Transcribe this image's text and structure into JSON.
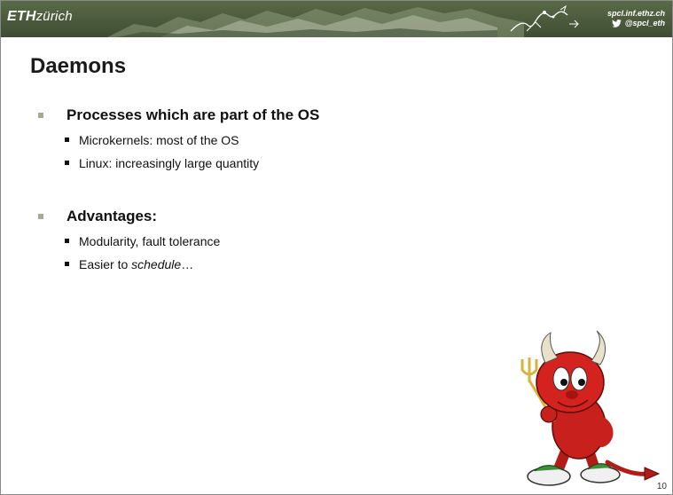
{
  "header": {
    "logo_bold": "ETH",
    "logo_text": "zürich",
    "website": "spcl.inf.ethz.ch",
    "twitter": "@spcl_eth",
    "icons": [
      "twitter-icon",
      "spcl-sketch-icon"
    ]
  },
  "slide": {
    "title": "Daemons",
    "bullets": [
      {
        "text": "Processes which are part of the OS",
        "children": [
          "Microkernels: most of the OS",
          "Linux: increasingly large quantity"
        ]
      },
      {
        "text": "Advantages:",
        "children": [
          "Modularity, fault tolerance",
          {
            "prefix": "Easier to ",
            "emphasis": "schedule",
            "suffix": "…"
          }
        ]
      }
    ],
    "page_number": "10"
  },
  "colors": {
    "header_bg": "#4d5b3d",
    "bullet_l1": "#a3ad8e",
    "mascot_red": "#c8201c"
  }
}
